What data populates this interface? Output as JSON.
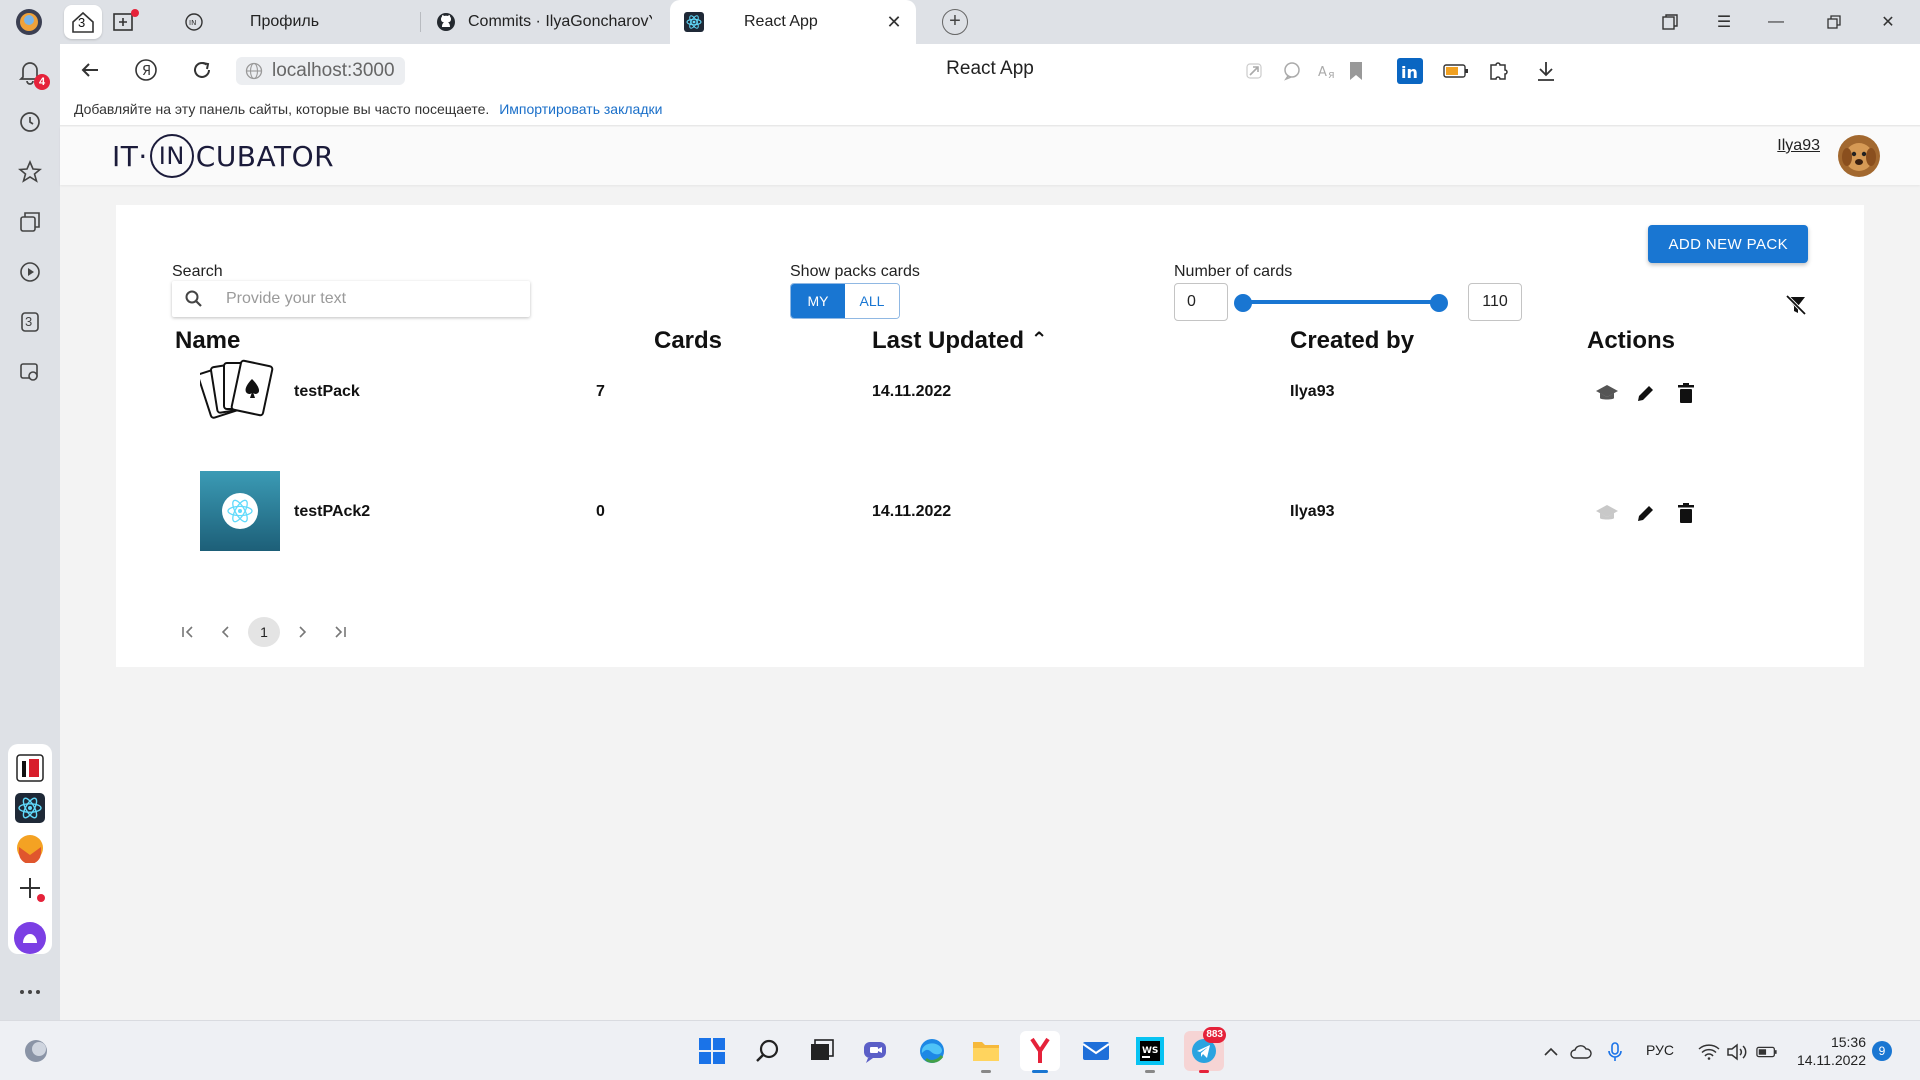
{
  "browser": {
    "tabs": [
      {
        "title": "Профиль"
      },
      {
        "title": "Commits · IlyaGoncharovY/"
      },
      {
        "title": "React App"
      }
    ],
    "tab_counter": "3",
    "url": "localhost:3000",
    "page_title": "React App",
    "bookmarks_hint": "Добавляйте на эту панель сайты, которые вы часто посещаете.",
    "bookmarks_link": "Импортировать закладки"
  },
  "sidebar": {
    "notifications_count": "4",
    "tab_counter": "3"
  },
  "app": {
    "logo_left": "IT·",
    "logo_ring": "IN",
    "logo_right": "CUBATOR",
    "user_name": "Ilya93",
    "add_button": "ADD NEW PACK",
    "search": {
      "label": "Search",
      "placeholder": "Provide your text",
      "value": ""
    },
    "show_packs": {
      "label": "Show packs cards",
      "my": "MY",
      "all": "ALL",
      "selected": "MY"
    },
    "number_of_cards": {
      "label": "Number of cards",
      "min": "0",
      "max": "110",
      "range": [
        0,
        110
      ]
    },
    "table": {
      "headers": {
        "name": "Name",
        "cards": "Cards",
        "updated": "Last Updated",
        "sort_icon": "⌃",
        "created": "Created by",
        "actions": "Actions"
      },
      "rows": [
        {
          "name": "testPack",
          "cards": "7",
          "updated": "14.11.2022",
          "created_by": "Ilya93",
          "cover": "playing-cards-icon",
          "learn_enabled": true
        },
        {
          "name": "testPAck2",
          "cards": "0",
          "updated": "14.11.2022",
          "created_by": "Ilya93",
          "cover": "react-logo-icon",
          "learn_enabled": false
        }
      ]
    },
    "pagination": {
      "current": "1"
    }
  },
  "taskbar": {
    "telegram_badge": "883",
    "language": "РУС",
    "time": "15:36",
    "date": "14.11.2022",
    "notifications": "9"
  },
  "colors": {
    "primary": "#1976d2",
    "chrome": "#dee1e6",
    "badge_red": "#e5223a"
  }
}
